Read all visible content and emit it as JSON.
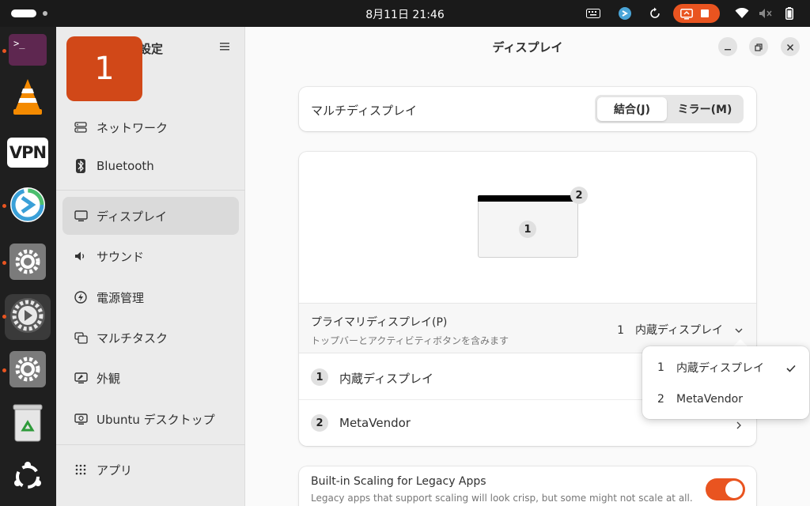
{
  "topbar": {
    "clock": "8月11日  21:46",
    "icons": [
      "keyboard-icon",
      "remote-desktop-icon",
      "refresh-icon",
      "screen-record-icon",
      "stop-icon",
      "wifi-icon",
      "volume-muted-icon",
      "battery-icon"
    ],
    "accent": "#e95420"
  },
  "dock": {
    "items": [
      "terminal",
      "vlc",
      "vpn",
      "remote-desktop",
      "settings",
      "settings-active",
      "settings",
      "trash",
      "ubuntu-apps"
    ],
    "vpn_label": "VPN"
  },
  "badge": {
    "text": "1"
  },
  "sidebar": {
    "title": "設定",
    "items": [
      {
        "label": "ネットワーク",
        "icon": "network-icon"
      },
      {
        "label": "Bluetooth",
        "icon": "bluetooth-icon"
      },
      {
        "label": "ディスプレイ",
        "icon": "display-icon",
        "selected": true
      },
      {
        "label": "サウンド",
        "icon": "sound-icon"
      },
      {
        "label": "電源管理",
        "icon": "power-icon"
      },
      {
        "label": "マルチタスク",
        "icon": "multitask-icon"
      },
      {
        "label": "外観",
        "icon": "appearance-icon"
      },
      {
        "label": "Ubuntu デスクトップ",
        "icon": "ubuntu-desktop-icon"
      },
      {
        "label": "アプリ",
        "icon": "apps-icon"
      }
    ]
  },
  "main": {
    "title": "ディスプレイ",
    "multi_display": {
      "label": "マルチディスプレイ",
      "join_label": "結合(J)",
      "mirror_label": "ミラー(M)",
      "selected": "join"
    },
    "arrangement": {
      "monitor1_number": "1",
      "monitor2_number": "2"
    },
    "primary": {
      "label": "プライマリディスプレイ(P)",
      "subtitle": "トップバーとアクティビティボタンを含みます",
      "value": "1　内蔵ディスプレイ"
    },
    "displays": [
      {
        "number": "1",
        "name": "内蔵ディスプレイ"
      },
      {
        "number": "2",
        "name": "MetaVendor"
      }
    ],
    "scaling": {
      "title": "Built-in Scaling for Legacy Apps",
      "subtitle": "Legacy apps that support scaling will look crisp, but some might not scale at all.",
      "enabled": true
    }
  },
  "popover": {
    "items": [
      {
        "number": "1",
        "label": "内蔵ディスプレイ",
        "checked": true
      },
      {
        "number": "2",
        "label": "MetaVendor",
        "checked": false
      }
    ]
  }
}
